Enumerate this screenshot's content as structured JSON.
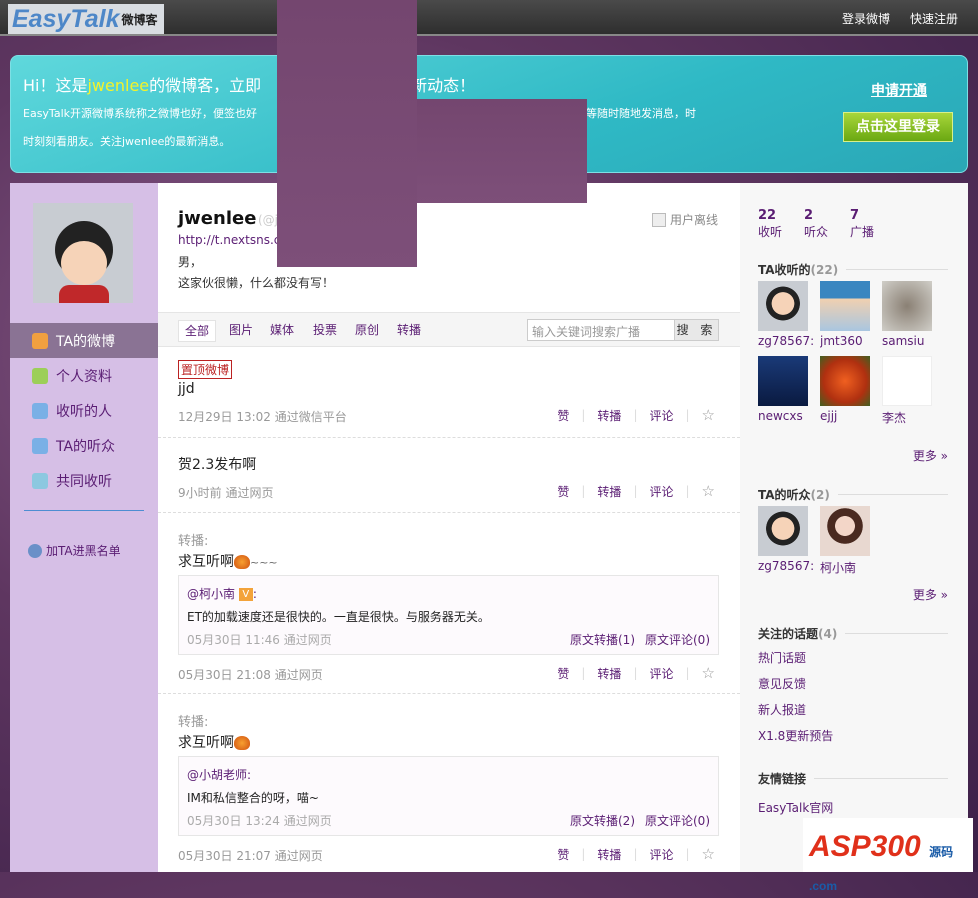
{
  "header": {
    "logo_en": "EasyTalk",
    "logo_cn": "微博客",
    "links": [
      "登录微博",
      "快速注册"
    ]
  },
  "banner": {
    "hi": "Hi！这是",
    "user": "jwenlee",
    "title_rest": "的微博客，立即",
    "title_end": "新动态！",
    "desc1": "EasyTalk开源微博系统称之微博也好，便签也好",
    "desc2": "可以通过手机、网页等随时随地发消息，时",
    "desc3": "时刻刻看朋友。关注jwenlee的最新消息。",
    "apply": "申请开通",
    "login": "点击这里登录"
  },
  "sidebar": {
    "items": [
      "TA的微博",
      "个人资料",
      "收听的人",
      "TA的听众",
      "共同收听"
    ],
    "blacklist": "加TA进黑名单"
  },
  "profile": {
    "name": "jwenlee",
    "handle": "(@j",
    "status": "用户离线",
    "url": "http://t.nextsns.c",
    "sex": "男，",
    "bio": "这家伙很懒，什么都没有写！"
  },
  "tabs": [
    "全部",
    "图片",
    "媒体",
    "投票",
    "原创",
    "转播"
  ],
  "search": {
    "placeholder": "输入关键词搜索广播",
    "button": "搜 索"
  },
  "actions": {
    "like": "赞",
    "forward": "转播",
    "comment": "评论"
  },
  "posts": [
    {
      "tag": "置顶微博",
      "content": "jjd",
      "meta": "12月29日 13:02 通过微信平台"
    },
    {
      "content": "贺2.3发布啊",
      "meta": "9小时前 通过网页"
    },
    {
      "rt_label": "转播:",
      "content": "求互听啊",
      "suffix": "~~~",
      "quote": {
        "who": "@柯小南",
        "v": "V",
        "text": "ET的加载速度还是很快的。一直是很快。与服务器无关。",
        "meta": "05月30日 11:46 通过网页",
        "fwd": "原文转播(1)",
        "cmt": "原文评论(0)"
      },
      "meta": "05月30日 21:08 通过网页"
    },
    {
      "rt_label": "转播:",
      "content": "求互听啊",
      "quote": {
        "who": "@小胡老师:",
        "text": "IM和私信整合的呀，喵~",
        "meta": "05月30日 13:24 通过网页",
        "fwd": "原文转播(2)",
        "cmt": "原文评论(0)"
      },
      "meta": "05月30日 21:07 通过网页"
    }
  ],
  "right": {
    "stats": [
      {
        "n": "22",
        "l": "收听"
      },
      {
        "n": "2",
        "l": "听众"
      },
      {
        "n": "7",
        "l": "广播"
      }
    ],
    "following": {
      "title": "TA收听的",
      "count": "(22)",
      "users": [
        "zg78567:",
        "jmt360",
        "samsiu",
        "newcxs",
        "ejjj",
        "李杰"
      ],
      "more": "更多 »"
    },
    "followers": {
      "title": "TA的听众",
      "count": "(2)",
      "users": [
        "zg78567:",
        "柯小南"
      ],
      "more": "更多 »"
    },
    "topics": {
      "title": "关注的话题",
      "count": "(4)",
      "items": [
        "热门话题",
        "意见反馈",
        "新人报道",
        "X1.8更新预告"
      ]
    },
    "links": {
      "title": "友情链接",
      "items": [
        "EasyTalk官网"
      ]
    }
  },
  "watermark": {
    "text": "ASP300",
    "sub": "源码 .com"
  }
}
